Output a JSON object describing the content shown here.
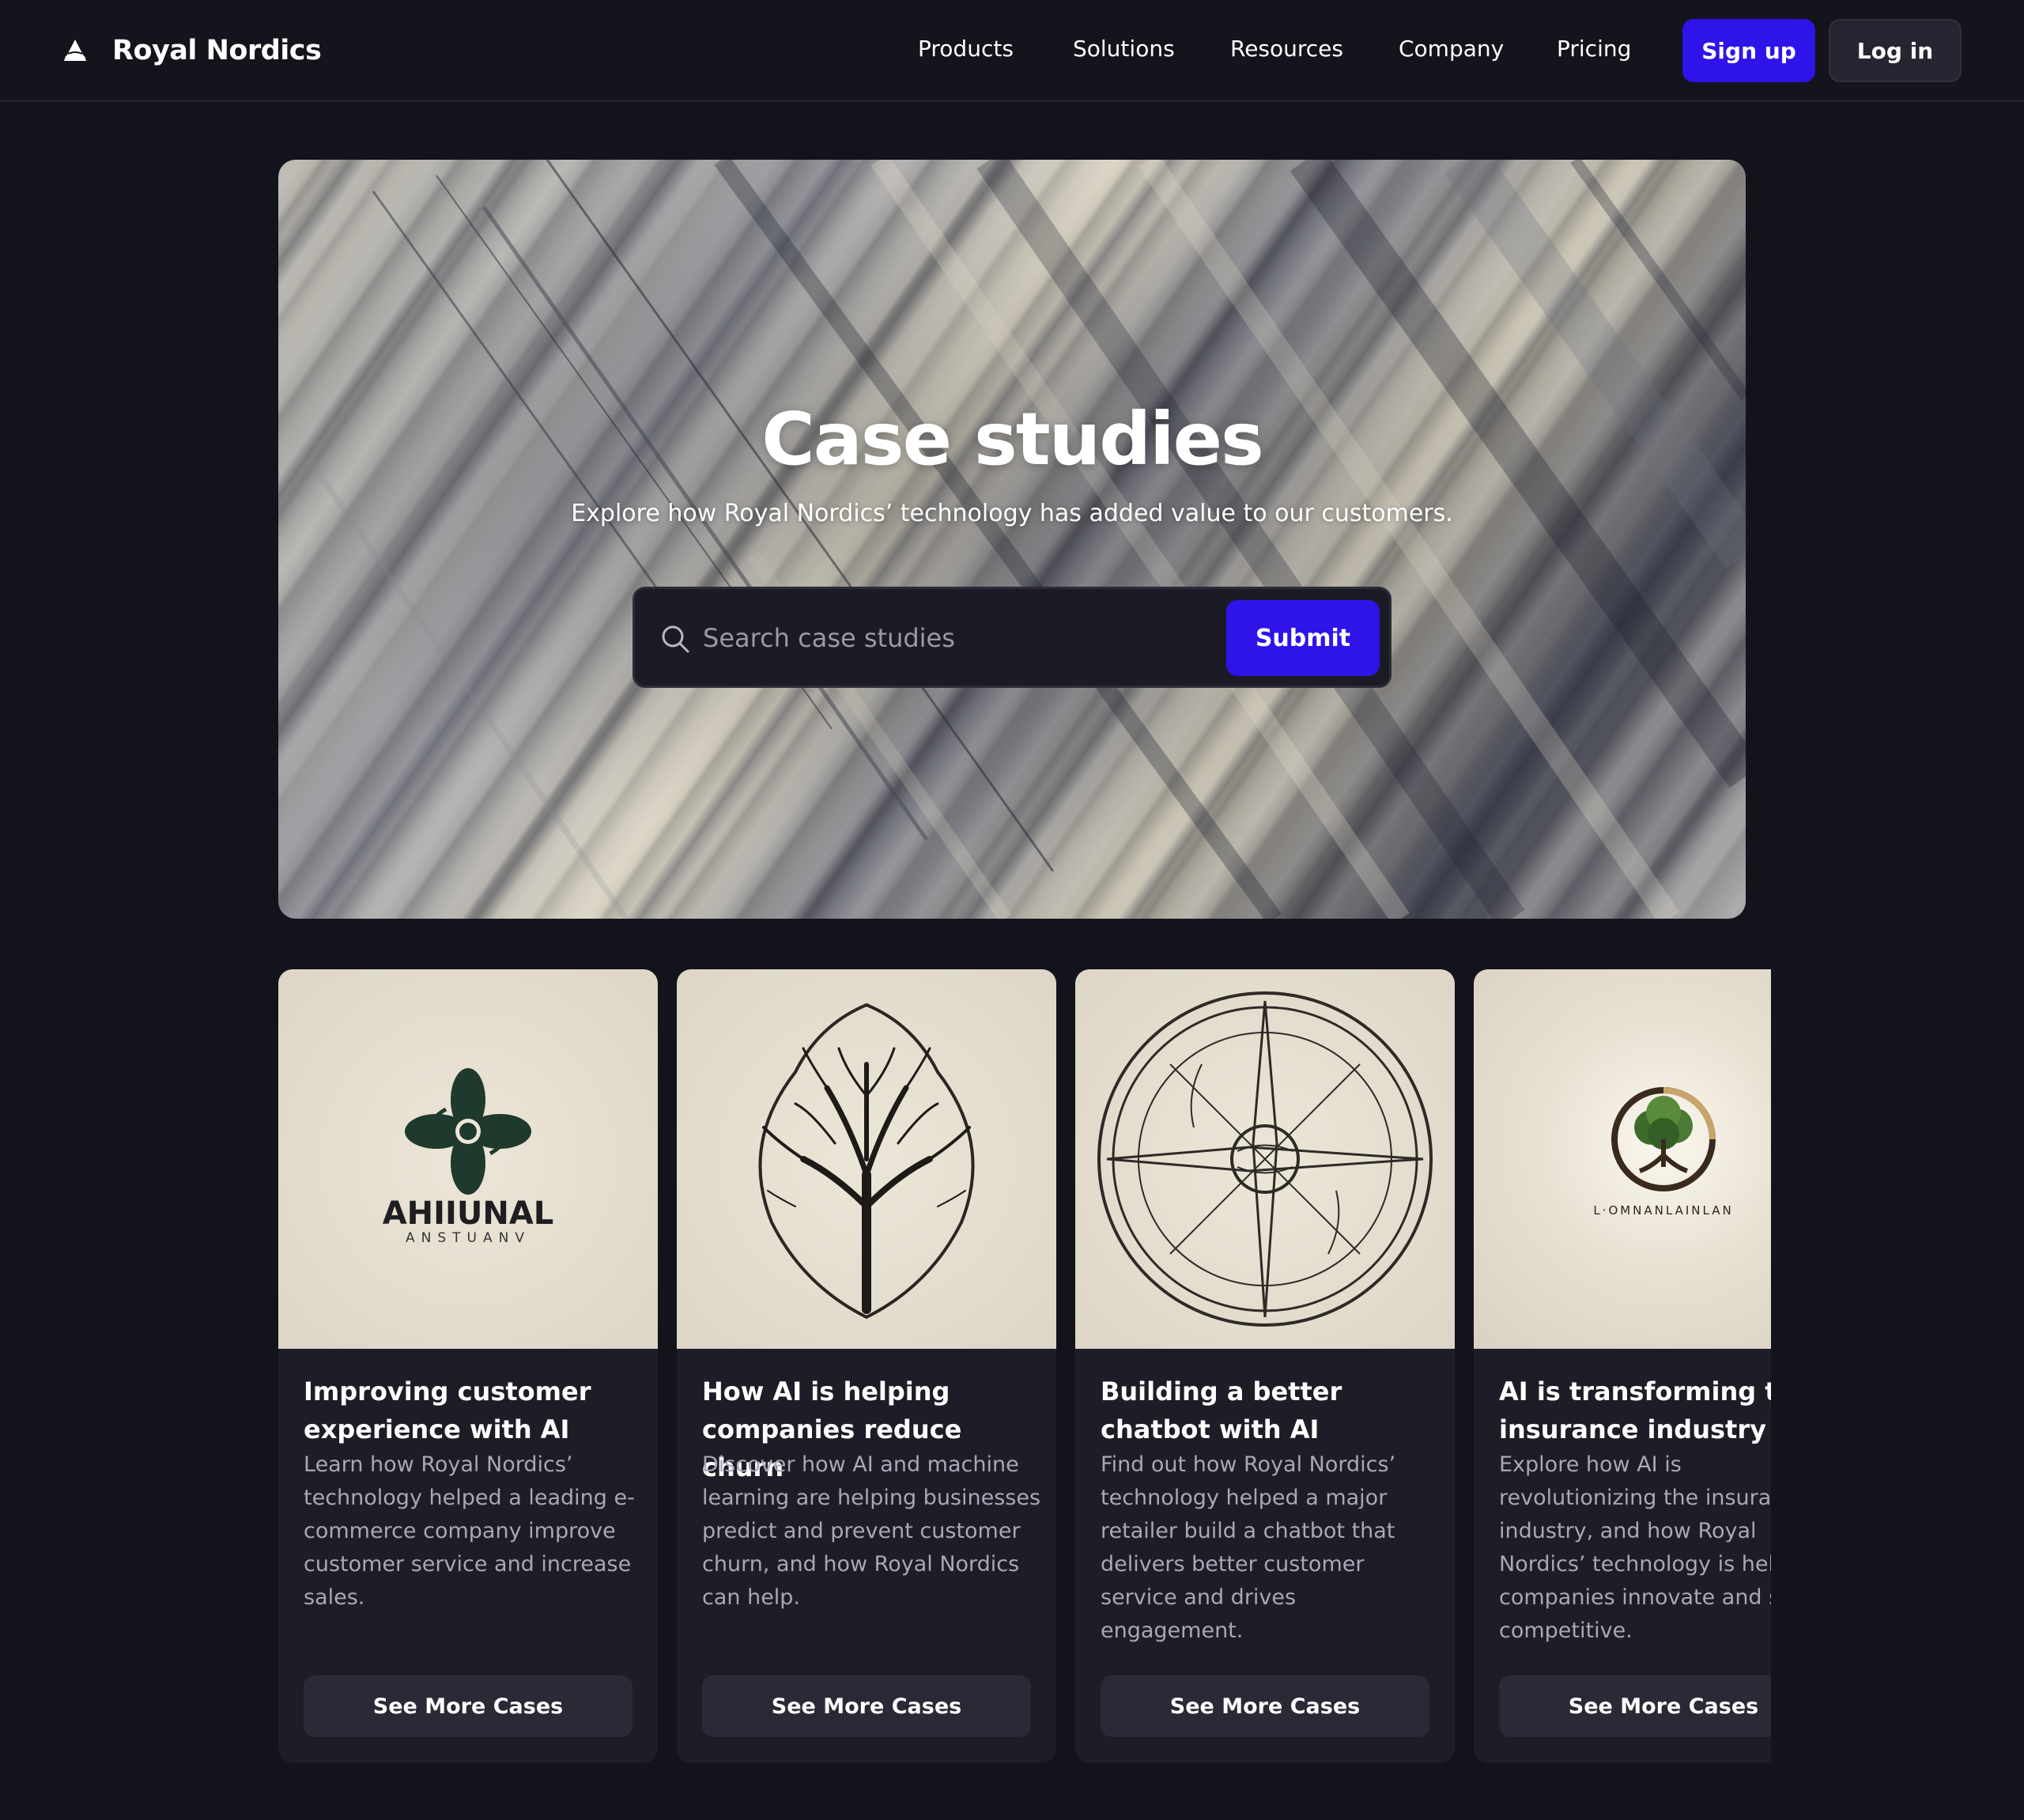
{
  "brand": {
    "name": "Royal Nordics",
    "icon": "sailboat-triangle-icon"
  },
  "nav": {
    "links": [
      "Products",
      "Solutions",
      "Resources",
      "Company",
      "Pricing"
    ],
    "signup_label": "Sign up",
    "login_label": "Log in"
  },
  "hero": {
    "title": "Case studies",
    "subtitle": "Explore how Royal Nordics’ technology has added value to our customers.",
    "search": {
      "placeholder": "Search case studies",
      "value": ""
    },
    "submit_label": "Submit"
  },
  "cards": [
    {
      "image": "leaf-flower-logo",
      "logo_text": "AHIIUNAL",
      "logo_subtext": "ANSTUANV",
      "title": "Improving customer experience with AI",
      "description": "Learn how Royal Nordics’ technology helped a leading e-commerce company improve customer service and increase sales.",
      "button_label": "See More Cases"
    },
    {
      "image": "tree-leaf-drawing",
      "title": "How AI is helping companies reduce churn",
      "description": "Discover how AI and machine learning are helping businesses predict and prevent customer churn, and how Royal Nordics can help.",
      "button_label": "See More Cases"
    },
    {
      "image": "compass-rose-drawing",
      "title": "Building a better chatbot with AI",
      "description": "Find out how Royal Nordics’ technology helped a major retailer build a chatbot that delivers better customer service and drives engagement.",
      "button_label": "See More Cases"
    },
    {
      "image": "tree-circle-logo",
      "logo_text": "L·OMNANLAINLAN",
      "title": "AI is transforming the insurance industry",
      "description": "Explore how AI is revolutionizing the insurance industry, and how Royal Nordics’ technology is helping companies innovate and stay competitive.",
      "button_label": "See More Cases"
    }
  ],
  "colors": {
    "background": "#13131c",
    "accent": "#2e14e8",
    "card": "#1d1d28",
    "muted_text": "#a8a8b6"
  }
}
